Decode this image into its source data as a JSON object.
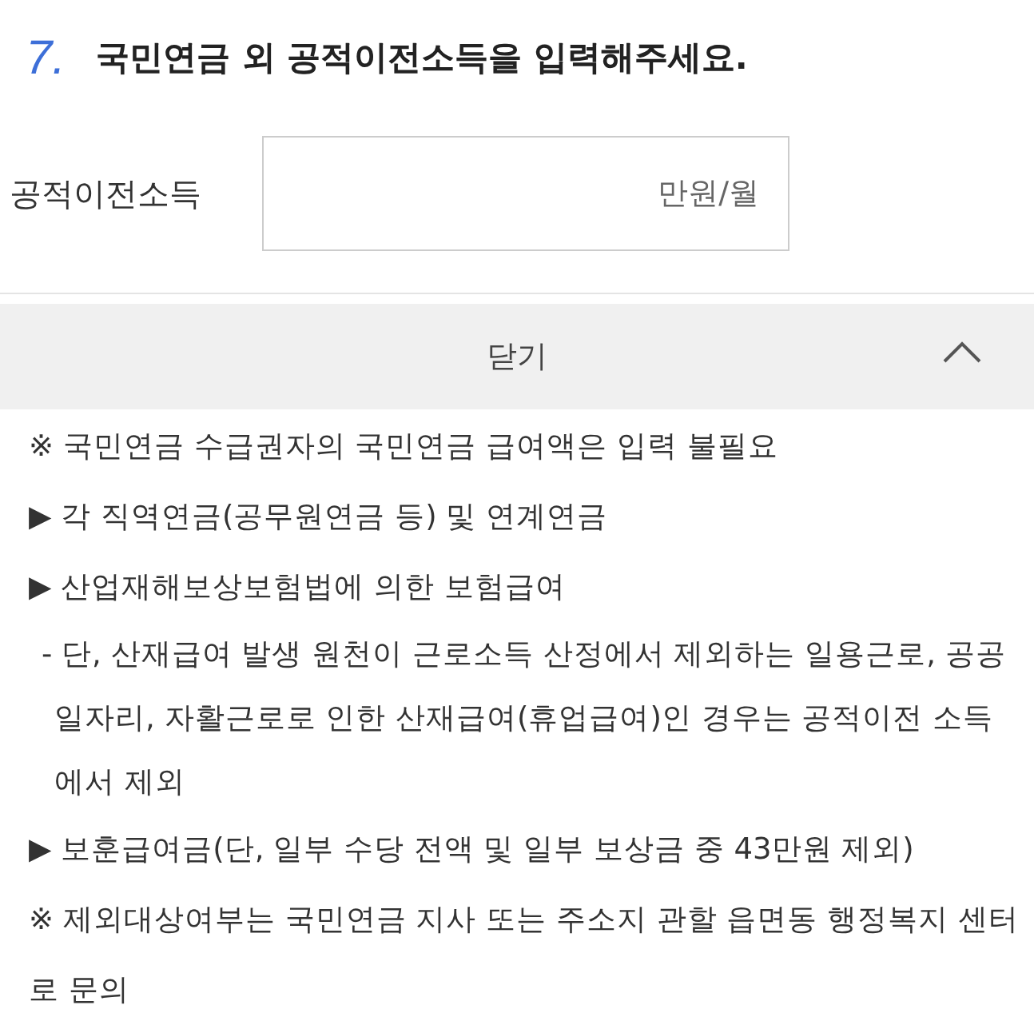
{
  "question": {
    "number": "7.",
    "title": "국민연금 외 공적이전소득을 입력해주세요."
  },
  "field": {
    "label": "공적이전소득",
    "placeholder": "만원/월"
  },
  "toggle": {
    "label": "닫기",
    "expanded": true
  },
  "notes": [
    {
      "kind": "note",
      "text": "※ 국민연금 수급권자의 국민연금 급여액은 입력 불필요"
    },
    {
      "kind": "bullet",
      "text": "▶ 각 직역연금(공무원연금 등) 및 연계연금"
    },
    {
      "kind": "bullet",
      "text": "▶ 산업재해보상보험법에 의한 보험급여"
    },
    {
      "kind": "sub",
      "text": "- 단, 산재급여 발생 원천이 근로소득 산정에서 제외하는 일용근로, 공공일자리, 자활근로로 인한 산재급여(휴업급여)인 경우는 공적이전 소득에서 제외"
    },
    {
      "kind": "bullet",
      "text": "▶ 보훈급여금(단, 일부 수당 전액 및 일부 보상금 중 43만원 제외)"
    },
    {
      "kind": "note",
      "text": "※ 제외대상여부는 국민연금 지사 또는 주소지 관할 읍면동 행정복지 센터로 문의"
    }
  ]
}
